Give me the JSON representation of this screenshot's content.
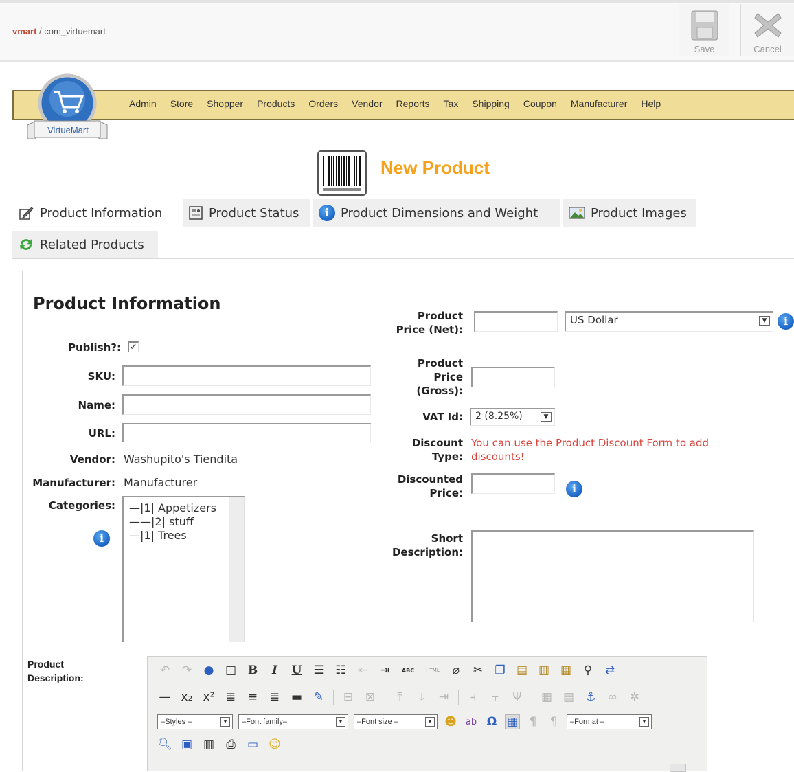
{
  "header": {
    "breadcrumb_first": "vmart",
    "breadcrumb_rest": " / com_virtuemart",
    "save_label": "Save",
    "cancel_label": "Cancel"
  },
  "logo_text": "VirtueMart",
  "menu": [
    "Admin",
    "Store",
    "Shopper",
    "Products",
    "Orders",
    "Vendor",
    "Reports",
    "Tax",
    "Shipping",
    "Coupon",
    "Manufacturer",
    "Help"
  ],
  "page_title": "New Product",
  "tabs": [
    {
      "label": "Product Information",
      "icon": "edit-icon",
      "active": true
    },
    {
      "label": "Product Status",
      "icon": "status-icon"
    },
    {
      "label": "Product Dimensions and Weight",
      "icon": "info-icon"
    },
    {
      "label": "Product Images",
      "icon": "image-icon"
    },
    {
      "label": "Related Products",
      "icon": "refresh-icon"
    }
  ],
  "form": {
    "section_title": "Product Information",
    "publish_label": "Publish?:",
    "publish_checked": true,
    "sku_label": "SKU:",
    "sku_value": "",
    "name_label": "Name:",
    "name_value": "",
    "url_label": "URL:",
    "url_value": "",
    "vendor_label": "Vendor:",
    "vendor_value": "Washupito's Tiendita",
    "manufacturer_label": "Manufacturer:",
    "manufacturer_value": "Manufacturer",
    "categories_label": "Categories:",
    "categories": [
      "—|1| Appetizers",
      "——|2| stuff",
      "—|1| Trees"
    ],
    "price_net_label_1": "Product",
    "price_net_label_2": "Price (Net):",
    "price_net_value": "",
    "currency_value": "US Dollar",
    "price_gross_label_1": "Product",
    "price_gross_label_2": "Price",
    "price_gross_label_3": "(Gross):",
    "price_gross_value": "",
    "vat_label": "VAT Id:",
    "vat_value": "2 (8.25%)",
    "discount_type_label_1": "Discount",
    "discount_type_label_2": "Type:",
    "discount_note_1": "You can use the Product Discount Form to add",
    "discount_note_2": "discounts!",
    "discounted_label_1": "Discounted",
    "discounted_label_2": "Price:",
    "discounted_value": "",
    "short_desc_label_1": "Short",
    "short_desc_label_2": "Description:",
    "product_desc_label_1": "Product",
    "product_desc_label_2": "Description:"
  },
  "editor": {
    "styles": "–Styles –",
    "font_family": "–Font family–",
    "font_size": "–Font size –",
    "format": "–Format –",
    "abc_label": "ABC",
    "html_label": "HTML",
    "bold_label": "B",
    "italic_label": "I",
    "underline_label": "U",
    "omega_label": "Ω"
  },
  "colors": {
    "accent": "#f7a11a",
    "menubar": "#f0dd98",
    "breadcrumb_link": "#c64934",
    "discount_note": "#d9463d",
    "info_blue": "#1a64c4"
  }
}
